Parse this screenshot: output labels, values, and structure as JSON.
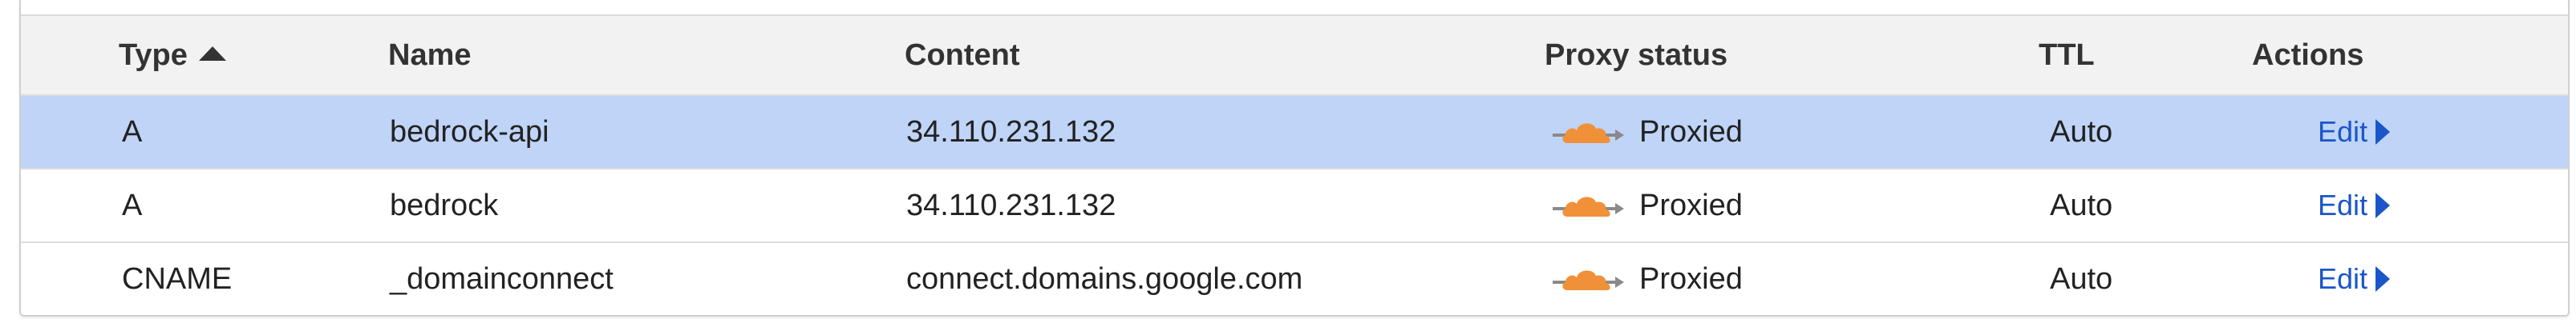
{
  "table": {
    "headers": {
      "type": "Type",
      "name": "Name",
      "content": "Content",
      "proxy_status": "Proxy status",
      "ttl": "TTL",
      "actions": "Actions"
    },
    "sort": {
      "column": "type",
      "direction": "ascending"
    },
    "rows": [
      {
        "type": "A",
        "name": "bedrock-api",
        "content": "34.110.231.132",
        "proxy_status": "Proxied",
        "ttl": "Auto",
        "action": "Edit",
        "selected": true
      },
      {
        "type": "A",
        "name": "bedrock",
        "content": "34.110.231.132",
        "proxy_status": "Proxied",
        "ttl": "Auto",
        "action": "Edit",
        "selected": false
      },
      {
        "type": "CNAME",
        "name": "_domainconnect",
        "content": "connect.domains.google.com",
        "proxy_status": "Proxied",
        "ttl": "Auto",
        "action": "Edit",
        "selected": false
      }
    ]
  },
  "colors": {
    "selected_row": "#bfd4f7",
    "header_bg": "#f2f2f2",
    "cloud_orange": "#f0913a",
    "link_blue": "#1a56c8"
  },
  "icons": {
    "proxy": "proxied-cloud-icon",
    "sort": "sort-ascending-icon",
    "edit": "caret-right-icon"
  }
}
